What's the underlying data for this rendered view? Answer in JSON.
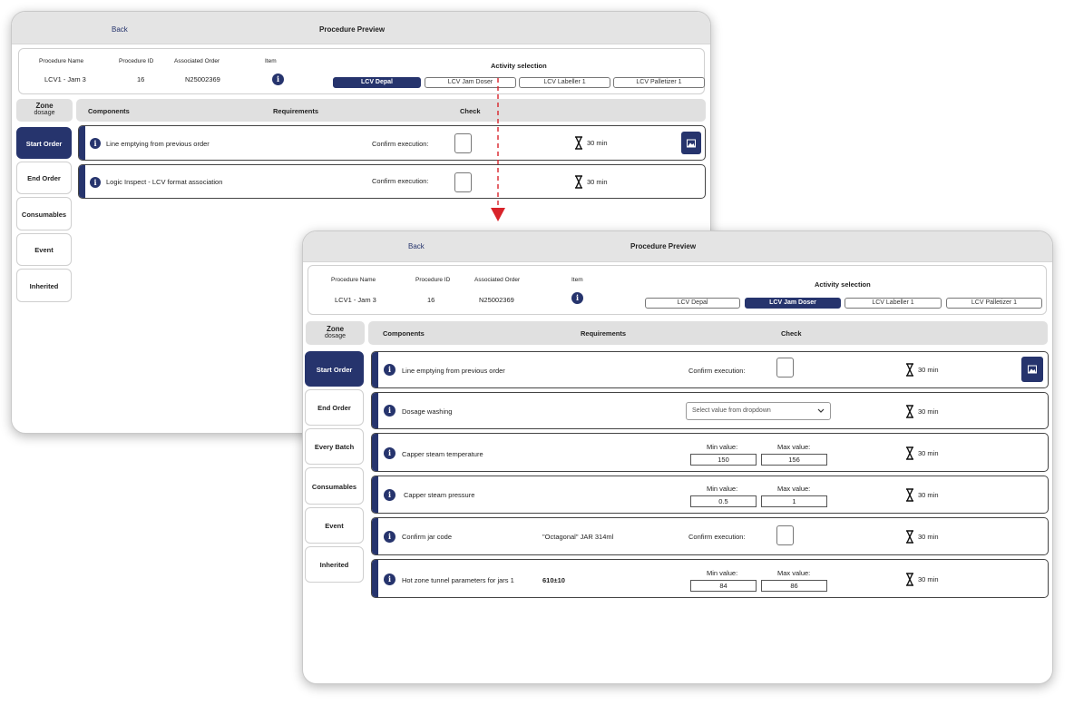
{
  "back_label": "Back",
  "title": "Procedure Preview",
  "info_labels": {
    "procedure_name": "Procedure Name",
    "procedure_id": "Procedure ID",
    "associated_order": "Associated Order",
    "item": "Item"
  },
  "procedure": {
    "name": "LCV1 - Jam 3",
    "id": "16",
    "order": "N25002369"
  },
  "activity_selection_label": "Activity selection",
  "activities": [
    "LCV Depal",
    "LCV Jam Doser",
    "LCV Labeller 1",
    "LCV Palletizer 1"
  ],
  "zone": {
    "label": "Zone",
    "sub": "dosage"
  },
  "headers": {
    "components": "Components",
    "requirements": "Requirements",
    "check": "Check"
  },
  "labels": {
    "confirm_execution": "Confirm execution:",
    "min_value": "Min value:",
    "max_value": "Max value:",
    "dropdown_placeholder": "Select value from dropdown"
  },
  "duration": "30 min",
  "screen1": {
    "active_activity": "LCV Depal",
    "sidebar": [
      "Start Order",
      "End Order",
      "Consumables",
      "Event",
      "Inherited"
    ],
    "rows": [
      {
        "name": "Line emptying from previous order"
      },
      {
        "name": "Logic Inspect - LCV format association"
      }
    ]
  },
  "screen2": {
    "active_activity": "LCV Jam Doser",
    "sidebar": [
      "Start Order",
      "End Order",
      "Every Batch",
      "Consumables",
      "Event",
      "Inherited"
    ],
    "rows": [
      {
        "name": "Line emptying from previous order"
      },
      {
        "name": "Dosage washing"
      },
      {
        "name": "Capper steam temperature",
        "min": "150",
        "max": "156"
      },
      {
        "name": "Capper steam pressure",
        "min": "0.5",
        "max": "1"
      },
      {
        "name": "Confirm jar code",
        "requirement": "\"Octagonal\" JAR 314ml"
      },
      {
        "name": "Hot zone tunnel parameters for jars 1",
        "requirement": "610±10",
        "min": "84",
        "max": "86"
      }
    ]
  },
  "colors": {
    "accent": "#26346d",
    "arrow": "#d8232a",
    "panel": "#e0e0e0"
  },
  "icons": [
    "info-icon",
    "hourglass-icon",
    "image-icon",
    "chevron-down-icon",
    "arrow-down-icon"
  ]
}
